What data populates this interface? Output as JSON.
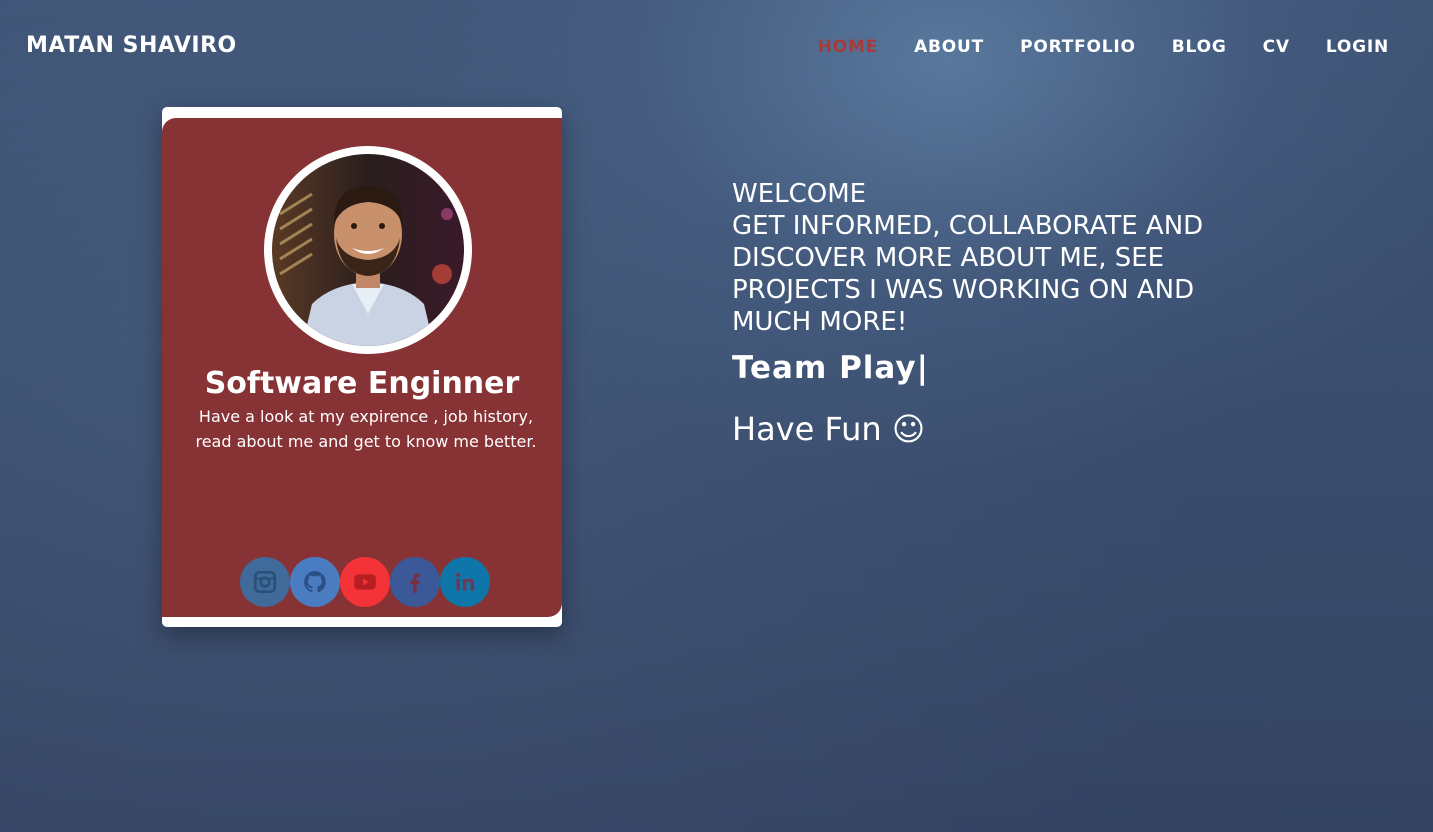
{
  "header": {
    "logo": "MATAN SHAVIRO",
    "nav": [
      {
        "label": "HOME",
        "active": true
      },
      {
        "label": "ABOUT",
        "active": false
      },
      {
        "label": "PORTFOLIO",
        "active": false
      },
      {
        "label": "BLOG",
        "active": false
      },
      {
        "label": "CV",
        "active": false
      },
      {
        "label": "LOGIN",
        "active": false
      }
    ]
  },
  "card": {
    "title": "Software Enginner",
    "description": "Have a look at my expirence , job history, read about me and get to know me better.",
    "socials": [
      {
        "icon": "instagram-icon",
        "color": "#3f6a9a"
      },
      {
        "icon": "github-icon",
        "color": "#4a7cc2"
      },
      {
        "icon": "youtube-icon",
        "color": "#f33338"
      },
      {
        "icon": "facebook-icon",
        "color": "#3b5998"
      },
      {
        "icon": "linkedin-icon",
        "color": "#0e76a8"
      }
    ]
  },
  "hero": {
    "welcome_line1": "WELCOME",
    "welcome_line2": "GET INFORMED, COLLABORATE AND DISCOVER MORE ABOUT ME, SEE PROJECTS I WAS WORKING ON AND MUCH MORE!",
    "typed_text": "Team Play|",
    "fun_text": "Have Fun ☺"
  },
  "colors": {
    "accent": "#a83a3a",
    "card_bg": "#873234"
  }
}
